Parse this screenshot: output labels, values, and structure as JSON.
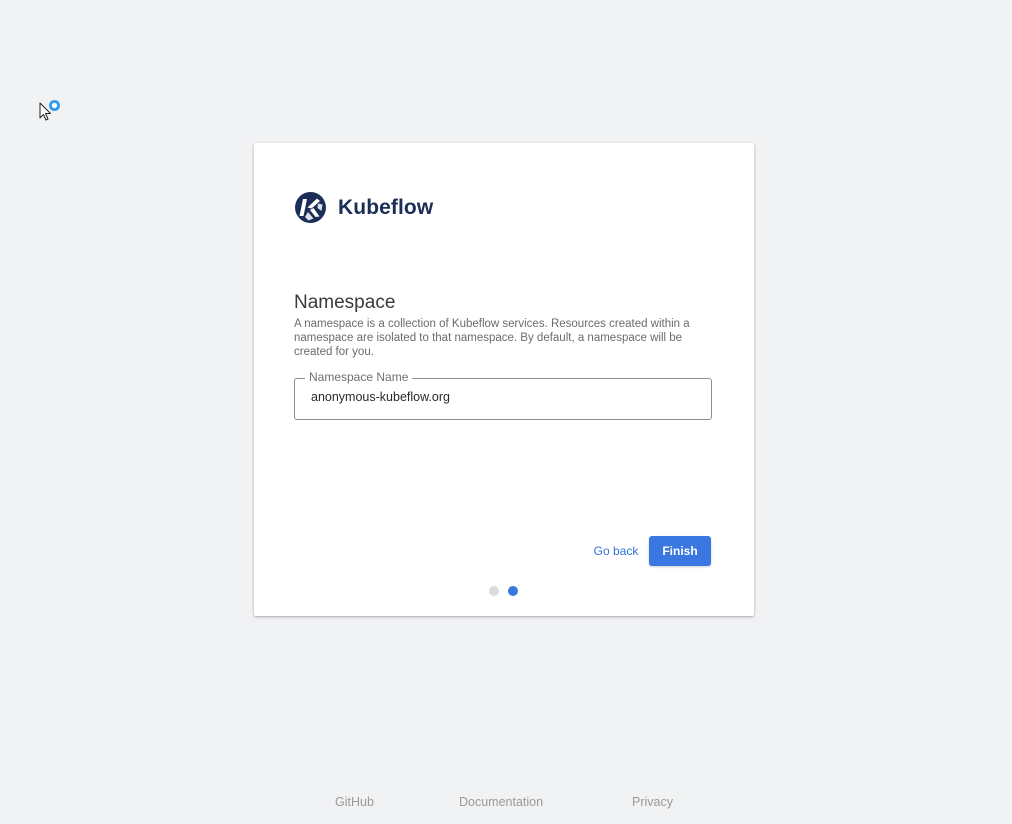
{
  "brand": {
    "name": "Kubeflow",
    "logo_icon": "kubeflow-logo-icon",
    "color": "#1c2e57"
  },
  "namespace": {
    "title": "Namespace",
    "description": "A namespace is a collection of Kubeflow services. Resources created within a namespace are isolated to that namespace. By default, a namespace will be created for you.",
    "field_label": "Namespace Name",
    "field_value": "anonymous-kubeflow.org"
  },
  "actions": {
    "back_label": "Go back",
    "finish_label": "Finish",
    "accent": "#3a77e0"
  },
  "stepper": {
    "total_steps": 2,
    "current_step": 2
  },
  "footer": {
    "github": "GitHub",
    "documentation": "Documentation",
    "privacy": "Privacy"
  },
  "cursor": {
    "icon": "busy-cursor-icon"
  }
}
